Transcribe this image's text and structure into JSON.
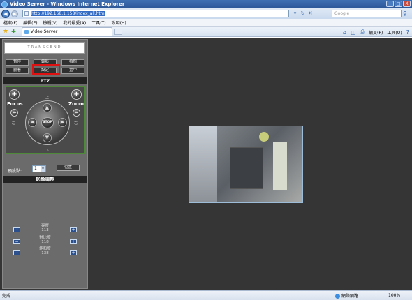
{
  "window": {
    "title": "Video Server - Windows Internet Explorer",
    "controls": [
      "_",
      "□",
      "X"
    ]
  },
  "address": {
    "url": "http://192.168.1.158/index_all.htm",
    "search_placeholder": "Google"
  },
  "menu": [
    "檔案(F)",
    "編輯(E)",
    "檢視(V)",
    "我的最愛(A)",
    "工具(T)",
    "說明(H)"
  ],
  "tabs": [
    {
      "label": "Video Server"
    }
  ],
  "commands": {
    "home": "",
    "page": "網頁(P)",
    "tools": "工具(O)"
  },
  "panel": {
    "logo_text": "TRANSCEND",
    "buttons": {
      "pause": "暫停",
      "record": "錄影",
      "snapshot": "拍照",
      "playback": "觀看",
      "settings": "設定",
      "fullscreen": "置中"
    },
    "ptz_header": "PTZ",
    "focus_label": "Focus",
    "zoom_label": "Zoom",
    "up_label": "上",
    "down_label": "下",
    "left_label": "左",
    "right_label": "右",
    "stop_label": "STOP",
    "preset_label": "預設點:",
    "preset_value": "1",
    "goto_button": "位置",
    "image_header": "影像調整",
    "brightness_label": "亮度",
    "brightness_value": "113",
    "contrast_label": "對比度",
    "contrast_value": "118",
    "saturation_label": "飽和度",
    "saturation_value": "138"
  },
  "status": {
    "left": "完成",
    "zone": "網際網路",
    "zoom": "100%"
  }
}
